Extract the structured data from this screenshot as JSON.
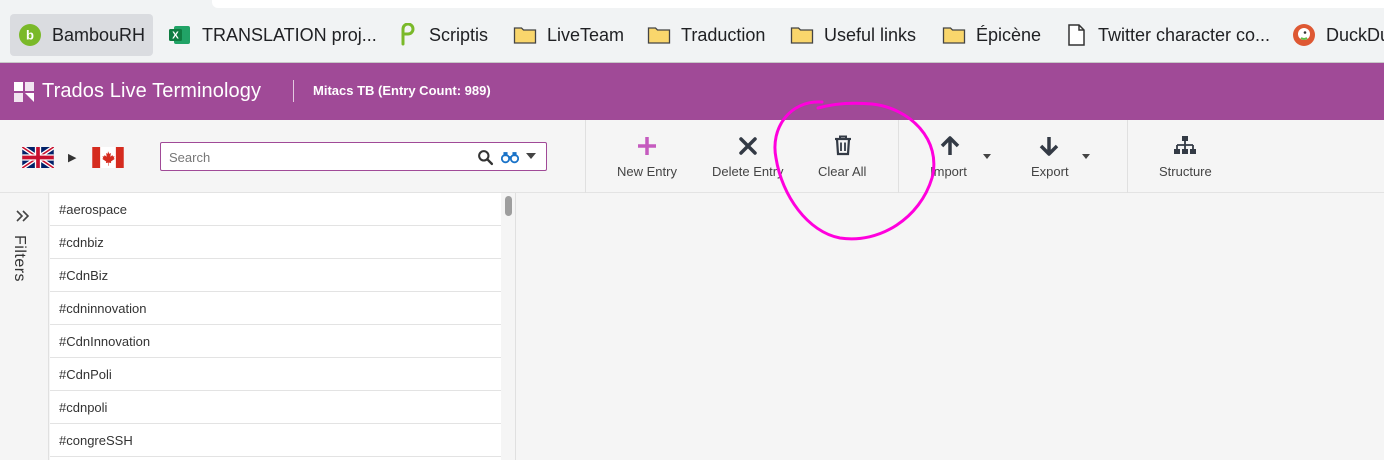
{
  "bookmarks": [
    {
      "label": "BambouRH",
      "icon": "bamboo-icon"
    },
    {
      "label": "TRANSLATION proj...",
      "icon": "excel-icon"
    },
    {
      "label": "Scriptis",
      "icon": "scriptis-icon"
    },
    {
      "label": "LiveTeam",
      "icon": "folder-icon"
    },
    {
      "label": "Traduction",
      "icon": "folder-icon"
    },
    {
      "label": "Useful links",
      "icon": "folder-icon"
    },
    {
      "label": "Épicène",
      "icon": "folder-icon"
    },
    {
      "label": "Twitter character co...",
      "icon": "document-icon"
    },
    {
      "label": "DuckDu",
      "icon": "duckduckgo-icon"
    }
  ],
  "header": {
    "title": "Trados Live Terminology",
    "termbase_info": "Mitacs TB (Entry Count: 989)"
  },
  "toolbar": {
    "search_placeholder": "Search",
    "source_language_icon": "uk-flag-icon",
    "target_language_icon": "canada-flag-icon",
    "new_entry": "New Entry",
    "delete_entry": "Delete Entry",
    "clear_all": "Clear All",
    "import": "Import",
    "export": "Export",
    "structure": "Structure"
  },
  "filters": {
    "label": "Filters"
  },
  "entries": [
    "#aerospace",
    "#cdnbiz",
    "#CdnBiz",
    "#cdninnovation",
    "#CdnInnovation",
    "#CdnPoli",
    "#cdnpoli",
    "#congreSSH"
  ],
  "colors": {
    "header": "#a04a97",
    "annotation": "#ff00dd",
    "new_entry_plus": "#c55bbf"
  }
}
